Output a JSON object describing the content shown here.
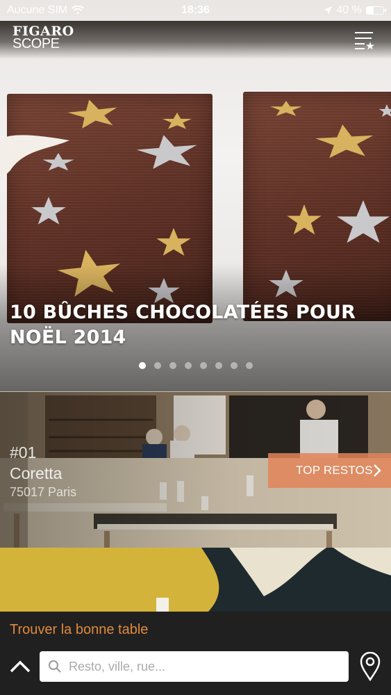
{
  "status_bar": {
    "carrier": "Aucune SIM",
    "time": "18:36",
    "battery_text": "40 %",
    "battery_level": 0.4
  },
  "header": {
    "logo_top": "FIGARO",
    "logo_bottom": "SCOPE",
    "menu_icon": "list-star-icon"
  },
  "hero": {
    "title": "10 BÛCHES CHOCOLATÉES POUR NOËL 2014",
    "slides_count": 8,
    "active_slide": 1
  },
  "resto_card": {
    "rank": "#01",
    "name": "Coretta",
    "city": "75017 Paris",
    "button_label": "TOP RESTOS"
  },
  "bottom_panel": {
    "title": "Trouver la bonne table",
    "search_placeholder": "Resto, ville, rue..."
  },
  "colors": {
    "accent_orange": "#e08a3c",
    "button_orange": "#e08458",
    "panel_bg": "#202020"
  }
}
